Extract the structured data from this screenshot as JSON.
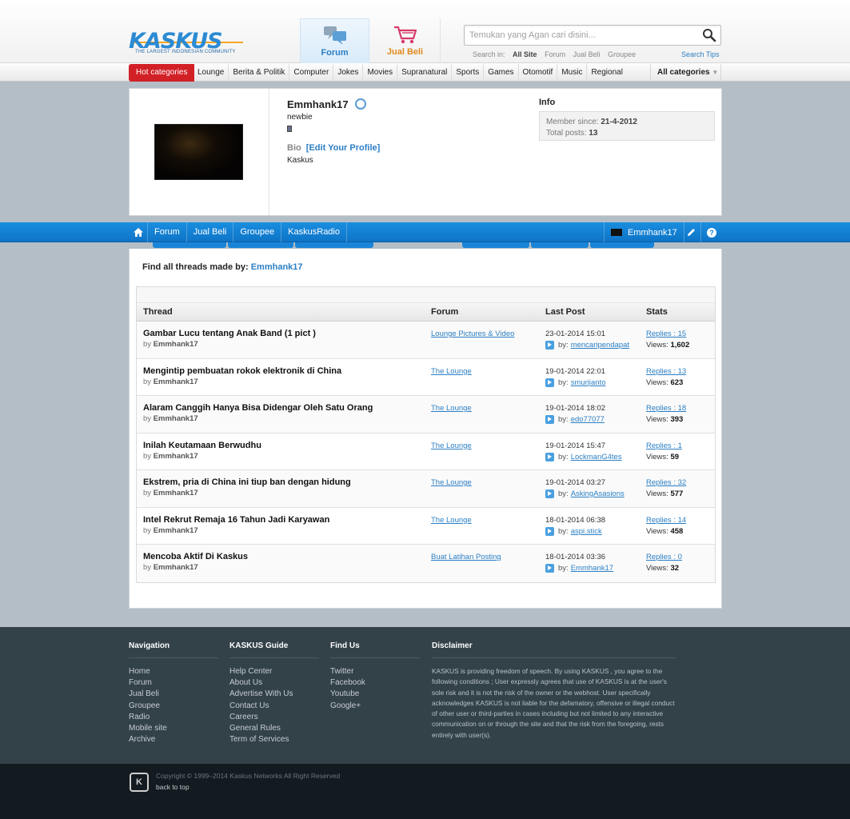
{
  "header": {
    "logo_text": "KASKUS",
    "logo_tagline": "THE LARGEST INDONESIAN COMMUNITY",
    "tabs": [
      {
        "label": "Forum",
        "icon": "forum-icon"
      },
      {
        "label": "Jual Beli",
        "icon": "shopping-cart-icon"
      }
    ],
    "search": {
      "placeholder": "Temukan yang Agan cari disini...",
      "in_label": "Search in:",
      "options": [
        "All Site",
        "Forum",
        "Jual Beli",
        "Groupee"
      ],
      "selected": "All Site",
      "tips": "Search Tips"
    }
  },
  "categories": {
    "hot": "Hot categories",
    "items": [
      "Lounge",
      "Berita & Politik",
      "Computer",
      "Jokes",
      "Movies",
      "Supranatural",
      "Sports",
      "Games",
      "Otomotif",
      "Music",
      "Regional"
    ],
    "all": "All categories"
  },
  "profile": {
    "username": "Emmhank17",
    "rank": "newbie",
    "bio_label": "Bio",
    "edit_profile": "[Edit Your Profile]",
    "bio_text": "Kaskus",
    "info_title": "Info",
    "member_since_label": "Member since:",
    "member_since": "21-4-2012",
    "total_posts_label": "Total posts:",
    "total_posts": "13"
  },
  "navbar": {
    "links": [
      "Forum",
      "Jual Beli",
      "Groupee",
      "KaskusRadio"
    ],
    "user": "Emmhank17"
  },
  "main": {
    "find_label": "Find all threads made by:",
    "find_user": "Emmhank17",
    "columns": [
      "Thread",
      "Forum",
      "Last Post",
      "Stats"
    ],
    "threads": [
      {
        "title": "Gambar Lucu tentang Anak Band (1 pict )",
        "by_label": "by",
        "author": "Emmhank17",
        "forum": "Lounge Pictures & Video",
        "last_post": "23-01-2014 15:01",
        "last_by_label": "by:",
        "last_user": "mencaripendapat",
        "replies": "Replies : 15",
        "views_label": "Views:",
        "views": "1,602"
      },
      {
        "title": "Mengintip pembuatan rokok elektronik di China",
        "by_label": "by",
        "author": "Emmhank17",
        "forum": "The Lounge",
        "last_post": "19-01-2014 22:01",
        "last_by_label": "by:",
        "last_user": "smurjianto",
        "replies": "Replies : 13",
        "views_label": "Views:",
        "views": "623"
      },
      {
        "title": "Alaram Canggih Hanya Bisa Didengar Oleh Satu Orang",
        "by_label": "by",
        "author": "Emmhank17",
        "forum": "The Lounge",
        "last_post": "19-01-2014 18:02",
        "last_by_label": "by:",
        "last_user": "edo77077",
        "replies": "Replies : 18",
        "views_label": "Views:",
        "views": "393"
      },
      {
        "title": "Inilah Keutamaan Berwudhu",
        "by_label": "by",
        "author": "Emmhank17",
        "forum": "The Lounge",
        "last_post": "19-01-2014 15:47",
        "last_by_label": "by:",
        "last_user": "LockmanG4tes",
        "replies": "Replies : 1",
        "views_label": "Views:",
        "views": "59"
      },
      {
        "title": "Ekstrem, pria di China ini tiup ban dengan hidung",
        "by_label": "by",
        "author": "Emmhank17",
        "forum": "The Lounge",
        "last_post": "19-01-2014 03:27",
        "last_by_label": "by:",
        "last_user": "AskingAsasions",
        "replies": "Replies : 32",
        "views_label": "Views:",
        "views": "577"
      },
      {
        "title": "Intel Rekrut Remaja 16 Tahun Jadi Karyawan",
        "by_label": "by",
        "author": "Emmhank17",
        "forum": "The Lounge",
        "last_post": "18-01-2014 06:38",
        "last_by_label": "by:",
        "last_user": "aspi.stick",
        "replies": "Replies : 14",
        "views_label": "Views:",
        "views": "458"
      },
      {
        "title": "Mencoba Aktif Di Kaskus",
        "by_label": "by",
        "author": "Emmhank17",
        "forum": "Buat Latihan Posting",
        "last_post": "18-01-2014 03:36",
        "last_by_label": "by:",
        "last_user": "Emmhank17",
        "replies": "Replies : 0",
        "views_label": "Views:",
        "views": "32"
      }
    ]
  },
  "footer": {
    "navigation": {
      "title": "Navigation",
      "links": [
        "Home",
        "Forum",
        "Jual Beli",
        "Groupee",
        "Radio",
        "Mobile site",
        "Archive"
      ]
    },
    "guide": {
      "title": "KASKUS Guide",
      "links": [
        "Help Center",
        "About Us",
        "Advertise With Us",
        "Contact Us",
        "Careers",
        "General Rules",
        "Term of Services"
      ]
    },
    "findus": {
      "title": "Find Us",
      "links": [
        "Twitter",
        "Facebook",
        "Youtube",
        "Google+"
      ]
    },
    "disclaimer": {
      "title": "Disclaimer",
      "text": "KASKUS is providing freedom of speech. By using KASKUS , you agree to the following conditions ; User expressly agrees that use of KASKUS is at the user's sole risk and it is not the risk of the owner or the webhost. User specifically acknowledges KASKUS is not liable for the defamatory, offensive or illegal conduct of other user or third-parties in cases including but not limited to any interactive communication on or through the site and that the risk from the foregoing, rests entirely with user(s)."
    },
    "copyright": "Copyright © 1999–2014 Kaskus Networks All Right Reserved",
    "back_to_top": "back to top"
  },
  "colors": {
    "brand_blue": "#1380d3",
    "hot_red": "#d22027",
    "link_blue": "#2b7fc4",
    "jualbeli_orange": "#e08a1e",
    "footer_bg": "#334148"
  }
}
